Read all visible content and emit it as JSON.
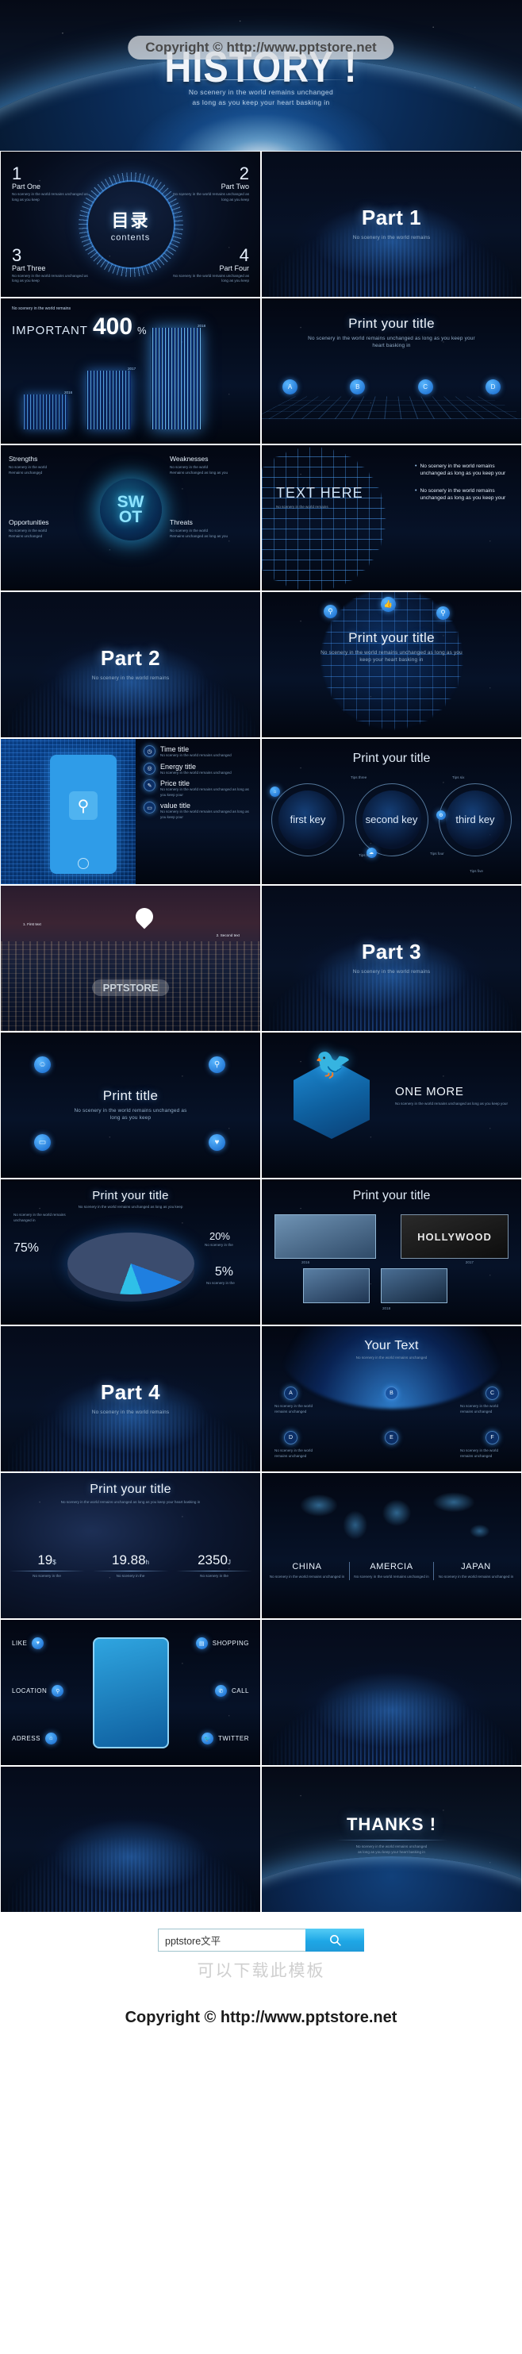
{
  "hero": {
    "title": "HISTORY !",
    "subtitle_line1": "No scenery in the world remains unchanged",
    "subtitle_line2": "as long as you keep your heart basking in",
    "watermark": "Copyright © http://www.pptstore.net"
  },
  "common": {
    "lede": "No scenery in the world remains",
    "body_long": "No scenery in the world remains unchanged as long as you keep your heart basking in",
    "body_short": "No scenery in the world remains unchanged as long as you keep",
    "caption_small": "No scenery in the world remains unchanged as long as you keep"
  },
  "slides": [
    {
      "id": "contents",
      "name": "contents-slide",
      "title_cn": "目录",
      "title_en": "contents",
      "items": [
        {
          "num": "1",
          "label": "Part One",
          "desc": "No scenery in the world remains unchanged as long as you keep"
        },
        {
          "num": "2",
          "label": "Part Two",
          "desc": "No scenery in the world remains unchanged as long as you keep"
        },
        {
          "num": "3",
          "label": "Part Three",
          "desc": "No scenery in the world remains unchanged as long as you keep"
        },
        {
          "num": "4",
          "label": "Part Four",
          "desc": "No scenery in the world remains unchanged as long as you keep"
        }
      ]
    },
    {
      "id": "part1",
      "name": "part-1-divider",
      "title": "Part 1",
      "subtitle": "No scenery in the world remains"
    },
    {
      "id": "important",
      "name": "important-bar-chart-slide",
      "lede": "No scenery in the world remains",
      "label": "IMPORTANT",
      "value": "400",
      "unit": "%",
      "bar_years": [
        "2016",
        "2017",
        "2018"
      ]
    },
    {
      "id": "print-title-icons",
      "name": "print-your-title-icons-slide",
      "title": "Print your title",
      "subtitle": "No scenery in the world remains unchanged as long as you keep your heart basking in",
      "nodes": [
        "A",
        "B",
        "C",
        "D"
      ]
    },
    {
      "id": "swot",
      "name": "swot-slide",
      "center_top": "SW",
      "center_bottom": "OT",
      "quadrants": [
        {
          "heading": "Strengths",
          "bullets": [
            "No scenery in the world",
            "Remains unchanged"
          ]
        },
        {
          "heading": "Weaknesses",
          "bullets": [
            "No scenery in the world",
            "Remains unchanged as long as you"
          ]
        },
        {
          "heading": "Opportunities",
          "bullets": [
            "No scenery in the world",
            "Remains unchanged"
          ]
        },
        {
          "heading": "Threats",
          "bullets": [
            "No scenery in the world",
            "Remains unchanged as long as you"
          ]
        }
      ]
    },
    {
      "id": "text-here",
      "name": "text-here-globe-slide",
      "title": "TEXT HERE",
      "subtitle": "No scenery in the world remains",
      "bullets": [
        "No scenery in the world remains unchanged as long as you keep your",
        "No scenery in the world remains unchanged as long as you keep your"
      ]
    },
    {
      "id": "part2",
      "name": "part-2-divider",
      "title": "Part 2",
      "subtitle": "No scenery in the world remains"
    },
    {
      "id": "print-title-globe",
      "name": "print-your-title-globe-slide",
      "title": "Print your title",
      "subtitle": "No scenery in the world remains unchanged as long as you keep your heart basking in",
      "pins": [
        "pin-icon",
        "thumb-up-icon",
        "pin-icon"
      ]
    },
    {
      "id": "phone-list",
      "name": "phone-feature-list-slide",
      "features": [
        {
          "title": "Time title",
          "desc": "No scenery in the world remains unchanged"
        },
        {
          "title": "Energy title",
          "desc": "No scenery in the world remains unchanged"
        },
        {
          "title": "Price title",
          "desc": "No scenery in the world remains unchanged as long as you keep your"
        },
        {
          "title": "value title",
          "desc": "No scenery in the world remains unchanged as long as you keep your"
        }
      ]
    },
    {
      "id": "three-keys",
      "name": "three-keys-slide",
      "title": "Print your title",
      "keys": [
        "first key",
        "second key",
        "third key"
      ],
      "tips": [
        "Tips one",
        "Tips two",
        "Tips three",
        "Tips four",
        "Tips five",
        "Tips six"
      ]
    },
    {
      "id": "city",
      "name": "city-map-pin-slide",
      "labels": [
        "1. First text",
        "2. Second text"
      ]
    },
    {
      "id": "part3",
      "name": "part-3-divider",
      "title": "Part 3",
      "subtitle": "No scenery in the world remains"
    },
    {
      "id": "print-title-4icons",
      "name": "print-title-four-icons-slide",
      "title": "Print title",
      "subtitle": "No scenery in the world remains unchanged as long as you keep",
      "icons": [
        "user-icon",
        "pin-icon",
        "chat-icon",
        "heart-icon"
      ]
    },
    {
      "id": "one-more",
      "name": "one-more-slide",
      "title": "ONE MORE",
      "subtitle": "No scenery in the world remains unchanged as long as you keep your",
      "icon": "twitter-bird-icon"
    },
    {
      "id": "pie",
      "name": "pie-chart-slide",
      "title": "Print your title",
      "subtitle": "No scenery in the world remains unchanged as long as you keep",
      "slices": [
        {
          "value": "75%",
          "label": "No scenery in the world remains unchanged in"
        },
        {
          "value": "20%",
          "label": "No scenery in the"
        },
        {
          "value": "5%",
          "label": "No scenery in the"
        }
      ]
    },
    {
      "id": "gallery",
      "name": "photo-gallery-slide",
      "title": "Print your title",
      "captions": [
        "2016",
        "2017",
        "2018"
      ],
      "banner": "HOLLYWOOD"
    },
    {
      "id": "part4",
      "name": "part-4-divider",
      "title": "Part 4",
      "subtitle": "No scenery in the world remains"
    },
    {
      "id": "your-text",
      "name": "your-text-circle-slide",
      "title": "Your Text",
      "subtitle": "No scenery in the world remains unchanged",
      "nodes": [
        "A",
        "B",
        "C",
        "D",
        "E",
        "F"
      ],
      "node_desc": "No scenery in the world remains unchanged"
    },
    {
      "id": "stats",
      "name": "statistics-slide",
      "title": "Print your title",
      "subtitle": "No scenery in the world remains unchanged as long as you keep your heart basking in",
      "stats": [
        {
          "value": "19",
          "unit": "$",
          "desc": "No scenery in the"
        },
        {
          "value": "19.88",
          "unit": "h",
          "desc": "No scenery in the"
        },
        {
          "value": "2350",
          "unit": "J",
          "desc": "No scenery in the"
        }
      ]
    },
    {
      "id": "world-map",
      "name": "world-map-slide",
      "countries": [
        {
          "name": "CHINA",
          "desc": "No scenery in the world remains unchanged in"
        },
        {
          "name": "AMERCIA",
          "desc": "No scenery in the world remains unchanged in"
        },
        {
          "name": "JAPAN",
          "desc": "No scenery in the world remains unchanged in"
        }
      ]
    },
    {
      "id": "social",
      "name": "social-contact-slide",
      "left": [
        {
          "label": "LIKE",
          "icon": "heart-icon"
        },
        {
          "label": "LOCATION",
          "icon": "pin-icon"
        },
        {
          "label": "ADRESS",
          "icon": "home-icon"
        }
      ],
      "right": [
        {
          "label": "SHOPPING",
          "icon": "cart-icon"
        },
        {
          "label": "CALL",
          "icon": "phone-icon"
        },
        {
          "label": "TWITTER",
          "icon": "twitter-bird-icon"
        }
      ]
    },
    {
      "id": "fiber-a",
      "name": "fiber-texture-slide-a"
    },
    {
      "id": "fiber-b",
      "name": "fiber-texture-slide-b"
    },
    {
      "id": "thanks",
      "name": "thanks-slide",
      "title": "THANKS !",
      "subtitle_line1": "No scenery in the world remains unchanged",
      "subtitle_line2": "as long as you keep your heart basking in"
    }
  ],
  "footer": {
    "search_value": "pptstore文平",
    "search_placeholder": "pptstore文平",
    "search_icon": "search-icon",
    "download_hint": "可以下载此模板",
    "copyright": "Copyright © http://www.pptstore.net"
  },
  "colors": {
    "accent": "#2a8ff0",
    "accent_light": "#5cc8ff",
    "bg_dark": "#050a17",
    "text_muted": "#93aec9"
  }
}
